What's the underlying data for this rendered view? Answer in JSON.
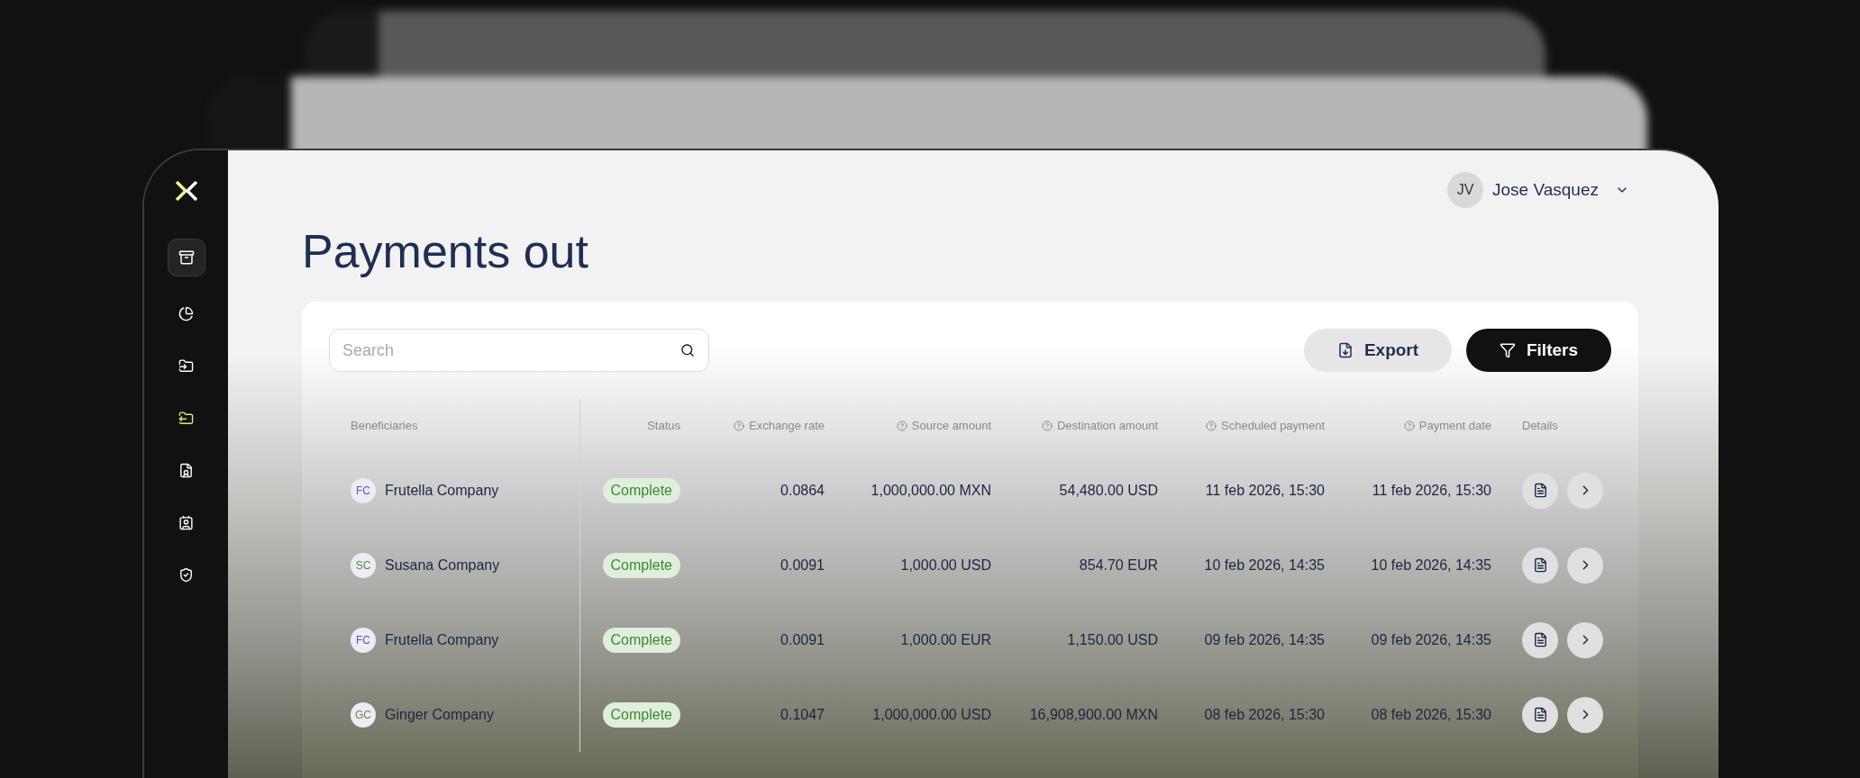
{
  "page": {
    "title": "Payments out"
  },
  "user": {
    "initials": "JV",
    "name": "Jose Vasquez"
  },
  "sidebar": {
    "items": [
      {
        "selected": false
      },
      {
        "selected": false
      },
      {
        "selected": true
      },
      {
        "selected": false
      },
      {
        "selected": false
      },
      {
        "selected": false
      }
    ]
  },
  "search": {
    "placeholder": "Search"
  },
  "actions": [
    {
      "kind": "export",
      "label": "Export"
    },
    {
      "kind": "filters",
      "label": "Filters"
    }
  ],
  "table": {
    "columns": [
      {
        "label": "Beneficiaries",
        "help": false
      },
      {
        "label": "Status",
        "help": false
      },
      {
        "label": "Exchange rate",
        "help": true
      },
      {
        "label": "Source amount",
        "help": true
      },
      {
        "label": "Destination amount",
        "help": true
      },
      {
        "label": "Scheduled payment",
        "help": true
      },
      {
        "label": "Payment date",
        "help": true
      },
      {
        "label": "Details",
        "help": false
      }
    ],
    "rows": [
      {
        "initials": "FC",
        "color": "#6b4fbb",
        "beneficiary": "Frutella Company",
        "status": "Complete",
        "exchange_rate": "0.0864",
        "source_amount": "1,000,000.00 MXN",
        "destination_amount": "54,480.00 USD",
        "scheduled_payment": "11 feb 2026, 15:30",
        "payment_date": "11 feb 2026, 15:30"
      },
      {
        "initials": "SC",
        "color": "#4f8a3c",
        "beneficiary": "Susana Company",
        "status": "Complete",
        "exchange_rate": "0.0091",
        "source_amount": "1,000.00 USD",
        "destination_amount": "854.70 EUR",
        "scheduled_payment": "10 feb 2026, 14:35",
        "payment_date": "10 feb 2026, 14:35"
      },
      {
        "initials": "FC",
        "color": "#6b4fbb",
        "beneficiary": "Frutella Company",
        "status": "Complete",
        "exchange_rate": "0.0091",
        "source_amount": "1,000.00 EUR",
        "destination_amount": "1,150.00 USD",
        "scheduled_payment": "09 feb 2026, 14:35",
        "payment_date": "09 feb 2026, 14:35"
      },
      {
        "initials": "GC",
        "color": "#8a7a3c",
        "beneficiary": "Ginger Company",
        "status": "Complete",
        "exchange_rate": "0.1047",
        "source_amount": "1,000,000.00 USD",
        "destination_amount": "16,908,900.00 MXN",
        "scheduled_payment": "08 feb 2026, 15:30",
        "payment_date": "08 feb 2026, 15:30"
      }
    ]
  }
}
